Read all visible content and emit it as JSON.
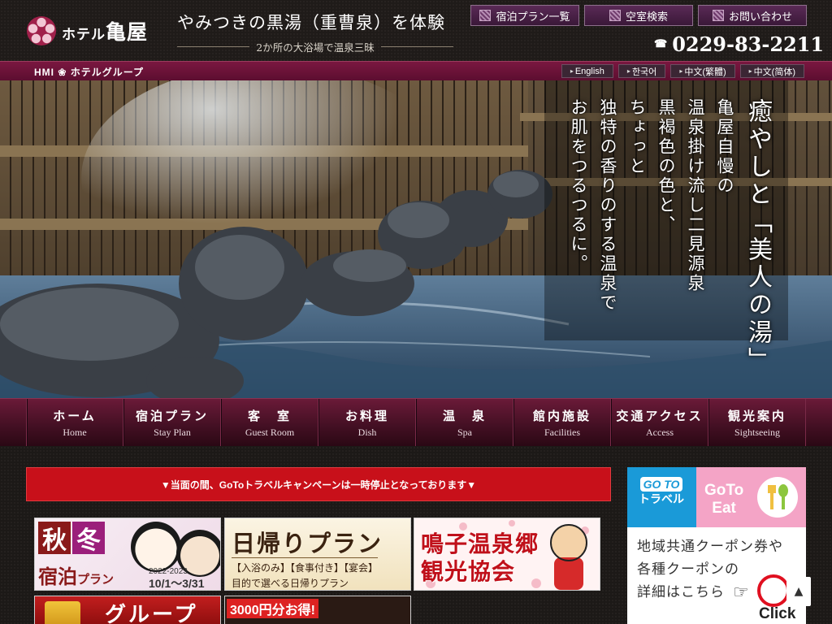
{
  "header": {
    "logo_prefix": "ホテル",
    "logo_name": "亀屋",
    "tagline": "やみつきの黒湯（重曹泉）を体験",
    "subline": "2か所の大浴場で温泉三昧",
    "top_buttons": [
      "宿泊プラン一覧",
      "空室検索",
      "お問い合わせ"
    ],
    "phone": "0229-83-2211",
    "phone_icon": "☎"
  },
  "group_bar": {
    "label": "HMI ❀ ホテルグループ",
    "languages": [
      "English",
      "한국어",
      "中文(繁體)",
      "中文(简体)"
    ]
  },
  "hero": {
    "copy_columns": [
      "癒やしと「美人の湯」",
      "亀屋自慢の",
      "温泉掛け流し二見源泉",
      "黒褐色の色と、",
      "ちょっと",
      "独特の香りのする温泉で",
      "お肌をつるつるに。"
    ]
  },
  "nav": {
    "items": [
      {
        "ja": "ホーム",
        "en": "Home"
      },
      {
        "ja": "宿泊プラン",
        "en": "Stay Plan"
      },
      {
        "ja": "客　室",
        "en": "Guest Room"
      },
      {
        "ja": "お料理",
        "en": "Dish"
      },
      {
        "ja": "温　泉",
        "en": "Spa"
      },
      {
        "ja": "館内施設",
        "en": "Facilities"
      },
      {
        "ja": "交通アクセス",
        "en": "Access"
      },
      {
        "ja": "観光案内",
        "en": "Sightseeing"
      }
    ]
  },
  "main": {
    "notice": "▼当面の間、GoToトラベルキャンペーンは一時停止となっております▼",
    "banners": {
      "autumn_winter": {
        "aki": "秋",
        "fuyu": "冬",
        "plan_a": "宿泊",
        "plan_b": "プラン",
        "year": "2022-2023",
        "date": "10/1～3/31"
      },
      "day_trip": {
        "title": "日帰りプラン",
        "sub1": "【入浴のみ】【食事付き】【宴会】",
        "sub2": "目的で選べる日帰りプラン"
      },
      "tourism": {
        "line1": "鳴子温泉郷",
        "line2": "観光協会"
      },
      "group": {
        "title": "グループ"
      },
      "coupon": {
        "title": "3000円分お得!"
      }
    },
    "side": {
      "goto_travel_top": "GO TO",
      "goto_travel_bottom": "トラベル",
      "goto_eat_top": "GoTo",
      "goto_eat_bottom": "Eat",
      "text_lines": [
        "地域共通クーポン券や",
        "各種クーポンの",
        "詳細はこちら"
      ],
      "click": "Click"
    },
    "page_top": "▲"
  },
  "colors": {
    "accent_purple": "#5a2a56",
    "nav_maroon": "#6a1a38",
    "notice_red": "#c8101a",
    "goto_blue": "#1a9ad8",
    "goto_pink": "#f4a4c6"
  }
}
